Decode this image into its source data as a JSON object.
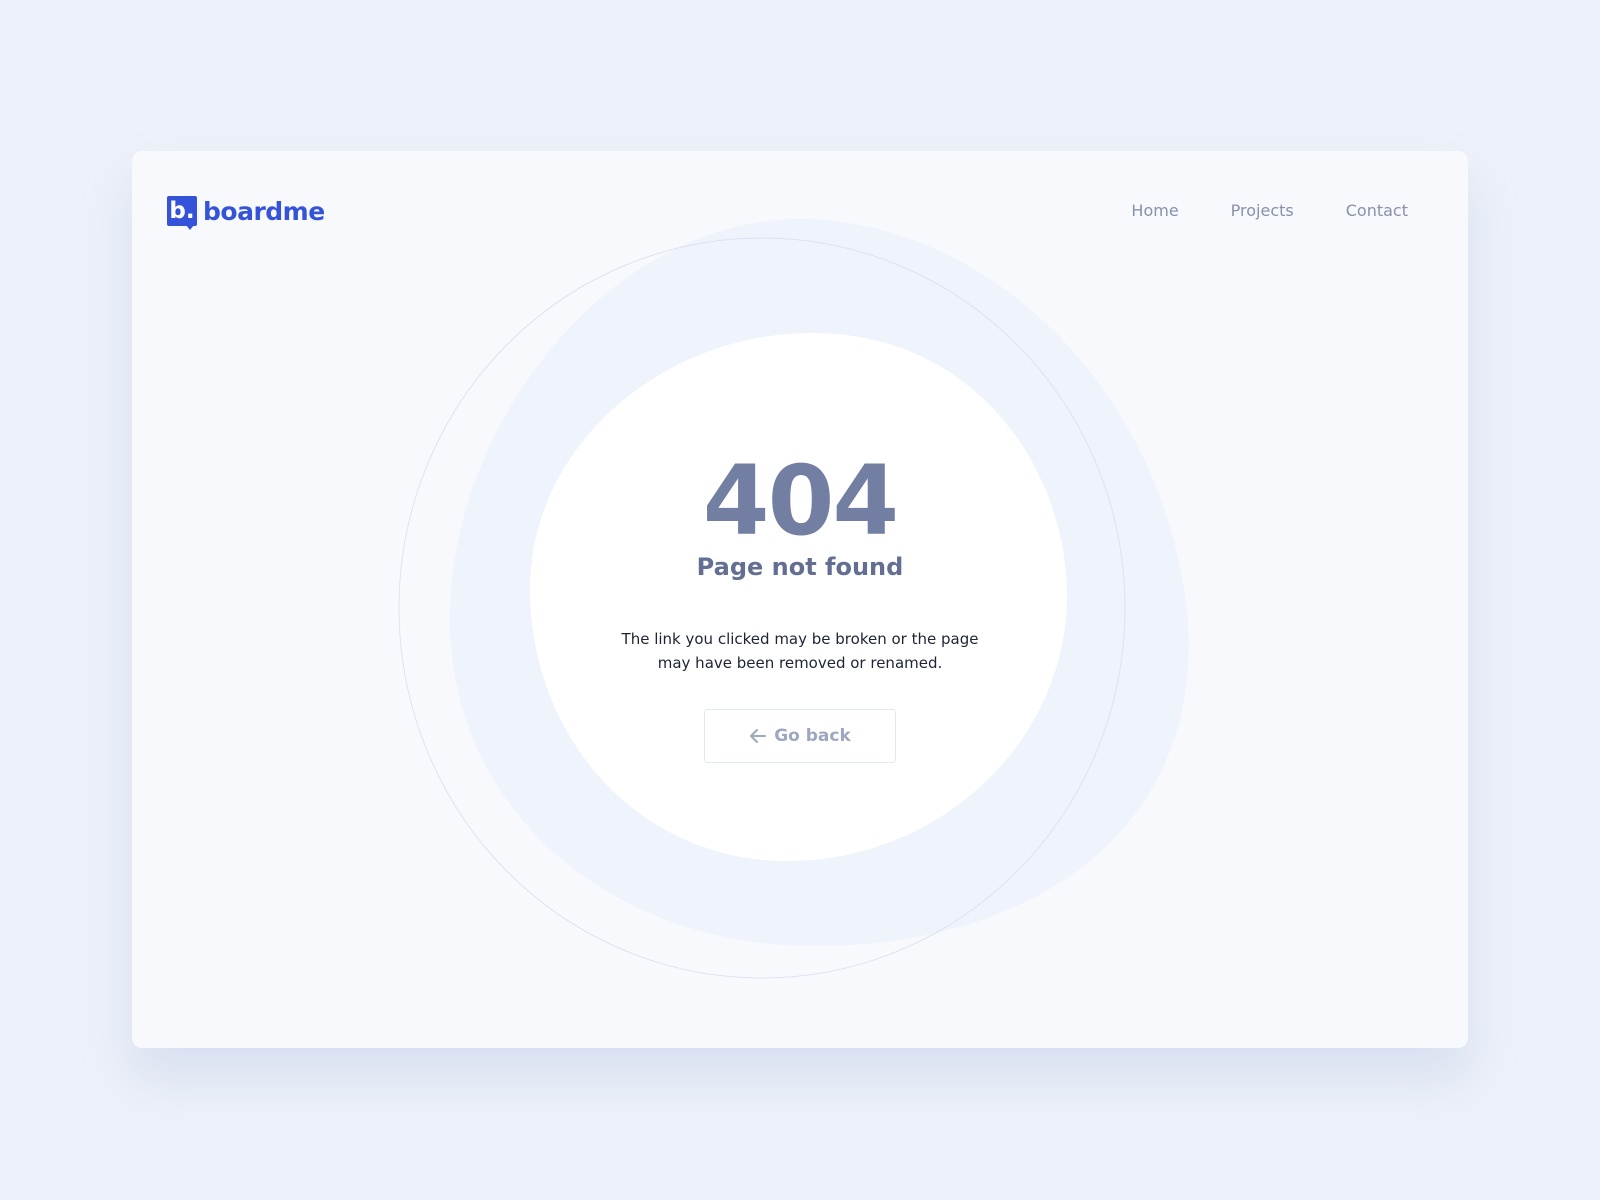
{
  "brand": {
    "mark": "b.",
    "name": "boardme",
    "color": "#3553d8"
  },
  "nav": {
    "items": [
      {
        "label": "Home"
      },
      {
        "label": "Projects"
      },
      {
        "label": "Contact"
      }
    ]
  },
  "error": {
    "code": "404",
    "title": "Page not found",
    "message": "The link you clicked may be broken or the page may have been removed or renamed."
  },
  "back_button": {
    "label": "Go back",
    "icon": "arrow-left-icon"
  },
  "colors": {
    "page_background": "#edf1f9",
    "card_background": "#f7f9fd",
    "code_text": "#737ea3",
    "title_text": "#636e92",
    "nav_text": "#8791aa"
  }
}
